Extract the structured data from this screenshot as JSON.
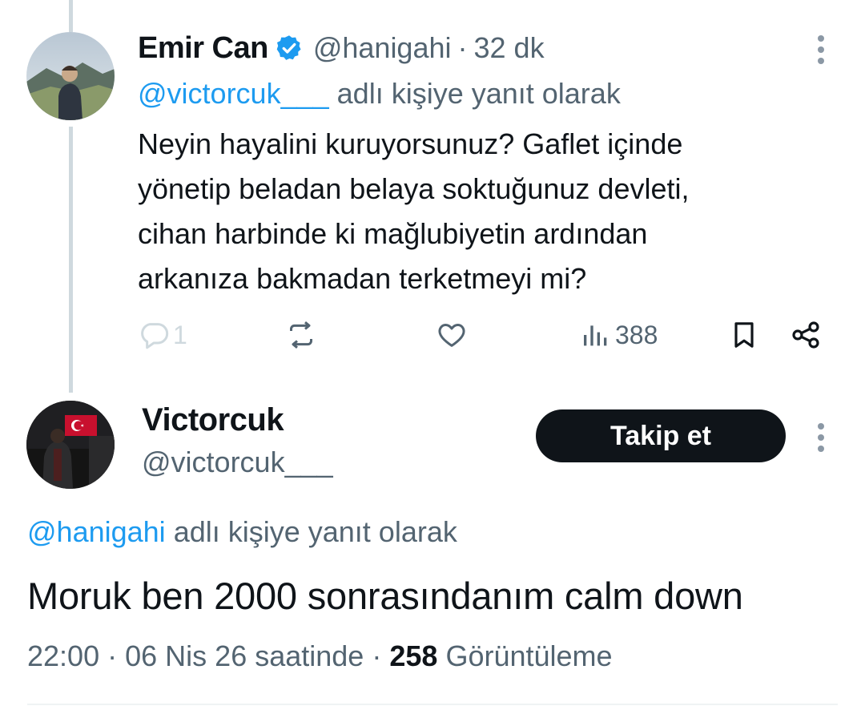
{
  "reply_tweet": {
    "author_name": "Emir Can",
    "verified": true,
    "handle": "@hanigahi",
    "separator": "·",
    "time_ago": "32 dk",
    "replying_to_handle": "@victorcuk___",
    "replying_to_suffix": "adlı kişiye yanıt olarak",
    "text_lines": [
      "Neyin hayalini kuruyorsunuz? Gaflet içinde",
      "yönetip beladan belaya soktuğunuz devleti,",
      "cihan harbinde ki mağlubiyetin ardından",
      "arkanıza bakmadan terketmeyi mi?"
    ],
    "actions": {
      "reply_count": "1",
      "retweet_icon": "retweet-icon",
      "like_icon": "heart-icon",
      "views_count": "388",
      "bookmark_icon": "bookmark-icon",
      "share_icon": "share-icon"
    }
  },
  "main_tweet": {
    "author_name": "Victorcuk",
    "handle": "@victorcuk___",
    "follow_label": "Takip et",
    "replying_to_handle": "@hanigahi",
    "replying_to_suffix": "adlı kişiye yanıt olarak",
    "text": "Moruk ben 2000 sonrasındanım calm down",
    "time": "22:00",
    "separator": "·",
    "date": "06 Nis 26 saatinde",
    "views_count": "258",
    "views_label": "Görüntüleme"
  },
  "colors": {
    "link": "#1d9bf0",
    "muted": "#536471",
    "text": "#0f1419",
    "thread_line": "#cfd9de",
    "verified": "#1d9bf0"
  }
}
